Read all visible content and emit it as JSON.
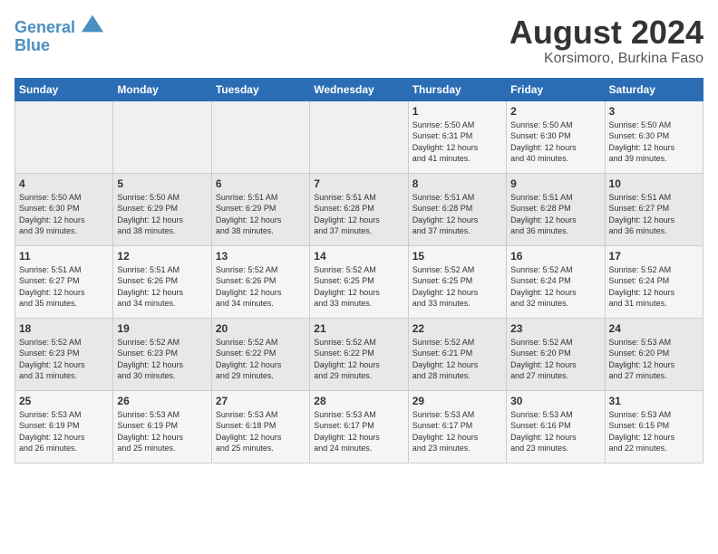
{
  "header": {
    "logo_line1": "General",
    "logo_line2": "Blue",
    "month": "August 2024",
    "location": "Korsimoro, Burkina Faso"
  },
  "weekdays": [
    "Sunday",
    "Monday",
    "Tuesday",
    "Wednesday",
    "Thursday",
    "Friday",
    "Saturday"
  ],
  "weeks": [
    [
      {
        "day": "",
        "detail": ""
      },
      {
        "day": "",
        "detail": ""
      },
      {
        "day": "",
        "detail": ""
      },
      {
        "day": "",
        "detail": ""
      },
      {
        "day": "1",
        "detail": "Sunrise: 5:50 AM\nSunset: 6:31 PM\nDaylight: 12 hours\nand 41 minutes."
      },
      {
        "day": "2",
        "detail": "Sunrise: 5:50 AM\nSunset: 6:30 PM\nDaylight: 12 hours\nand 40 minutes."
      },
      {
        "day": "3",
        "detail": "Sunrise: 5:50 AM\nSunset: 6:30 PM\nDaylight: 12 hours\nand 39 minutes."
      }
    ],
    [
      {
        "day": "4",
        "detail": "Sunrise: 5:50 AM\nSunset: 6:30 PM\nDaylight: 12 hours\nand 39 minutes."
      },
      {
        "day": "5",
        "detail": "Sunrise: 5:50 AM\nSunset: 6:29 PM\nDaylight: 12 hours\nand 38 minutes."
      },
      {
        "day": "6",
        "detail": "Sunrise: 5:51 AM\nSunset: 6:29 PM\nDaylight: 12 hours\nand 38 minutes."
      },
      {
        "day": "7",
        "detail": "Sunrise: 5:51 AM\nSunset: 6:28 PM\nDaylight: 12 hours\nand 37 minutes."
      },
      {
        "day": "8",
        "detail": "Sunrise: 5:51 AM\nSunset: 6:28 PM\nDaylight: 12 hours\nand 37 minutes."
      },
      {
        "day": "9",
        "detail": "Sunrise: 5:51 AM\nSunset: 6:28 PM\nDaylight: 12 hours\nand 36 minutes."
      },
      {
        "day": "10",
        "detail": "Sunrise: 5:51 AM\nSunset: 6:27 PM\nDaylight: 12 hours\nand 36 minutes."
      }
    ],
    [
      {
        "day": "11",
        "detail": "Sunrise: 5:51 AM\nSunset: 6:27 PM\nDaylight: 12 hours\nand 35 minutes."
      },
      {
        "day": "12",
        "detail": "Sunrise: 5:51 AM\nSunset: 6:26 PM\nDaylight: 12 hours\nand 34 minutes."
      },
      {
        "day": "13",
        "detail": "Sunrise: 5:52 AM\nSunset: 6:26 PM\nDaylight: 12 hours\nand 34 minutes."
      },
      {
        "day": "14",
        "detail": "Sunrise: 5:52 AM\nSunset: 6:25 PM\nDaylight: 12 hours\nand 33 minutes."
      },
      {
        "day": "15",
        "detail": "Sunrise: 5:52 AM\nSunset: 6:25 PM\nDaylight: 12 hours\nand 33 minutes."
      },
      {
        "day": "16",
        "detail": "Sunrise: 5:52 AM\nSunset: 6:24 PM\nDaylight: 12 hours\nand 32 minutes."
      },
      {
        "day": "17",
        "detail": "Sunrise: 5:52 AM\nSunset: 6:24 PM\nDaylight: 12 hours\nand 31 minutes."
      }
    ],
    [
      {
        "day": "18",
        "detail": "Sunrise: 5:52 AM\nSunset: 6:23 PM\nDaylight: 12 hours\nand 31 minutes."
      },
      {
        "day": "19",
        "detail": "Sunrise: 5:52 AM\nSunset: 6:23 PM\nDaylight: 12 hours\nand 30 minutes."
      },
      {
        "day": "20",
        "detail": "Sunrise: 5:52 AM\nSunset: 6:22 PM\nDaylight: 12 hours\nand 29 minutes."
      },
      {
        "day": "21",
        "detail": "Sunrise: 5:52 AM\nSunset: 6:22 PM\nDaylight: 12 hours\nand 29 minutes."
      },
      {
        "day": "22",
        "detail": "Sunrise: 5:52 AM\nSunset: 6:21 PM\nDaylight: 12 hours\nand 28 minutes."
      },
      {
        "day": "23",
        "detail": "Sunrise: 5:52 AM\nSunset: 6:20 PM\nDaylight: 12 hours\nand 27 minutes."
      },
      {
        "day": "24",
        "detail": "Sunrise: 5:53 AM\nSunset: 6:20 PM\nDaylight: 12 hours\nand 27 minutes."
      }
    ],
    [
      {
        "day": "25",
        "detail": "Sunrise: 5:53 AM\nSunset: 6:19 PM\nDaylight: 12 hours\nand 26 minutes."
      },
      {
        "day": "26",
        "detail": "Sunrise: 5:53 AM\nSunset: 6:19 PM\nDaylight: 12 hours\nand 25 minutes."
      },
      {
        "day": "27",
        "detail": "Sunrise: 5:53 AM\nSunset: 6:18 PM\nDaylight: 12 hours\nand 25 minutes."
      },
      {
        "day": "28",
        "detail": "Sunrise: 5:53 AM\nSunset: 6:17 PM\nDaylight: 12 hours\nand 24 minutes."
      },
      {
        "day": "29",
        "detail": "Sunrise: 5:53 AM\nSunset: 6:17 PM\nDaylight: 12 hours\nand 23 minutes."
      },
      {
        "day": "30",
        "detail": "Sunrise: 5:53 AM\nSunset: 6:16 PM\nDaylight: 12 hours\nand 23 minutes."
      },
      {
        "day": "31",
        "detail": "Sunrise: 5:53 AM\nSunset: 6:15 PM\nDaylight: 12 hours\nand 22 minutes."
      }
    ]
  ]
}
